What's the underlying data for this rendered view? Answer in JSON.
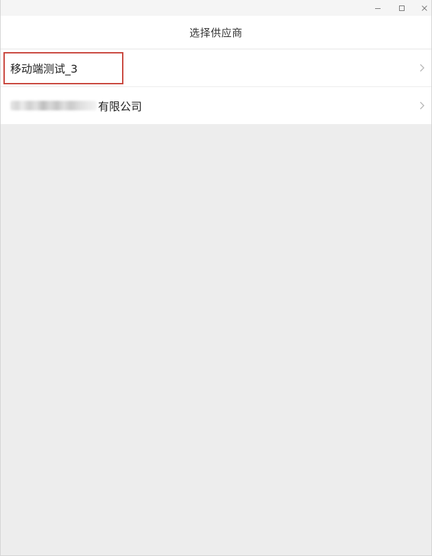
{
  "window": {
    "controls": {
      "minimize_icon": "minimize-icon",
      "maximize_icon": "maximize-icon",
      "close_icon": "close-icon"
    }
  },
  "navbar": {
    "title": "选择供应商"
  },
  "suppliers": [
    {
      "label": "移动端测试_3",
      "highlighted": true
    },
    {
      "label": "有限公司",
      "redacted_prefix": true
    }
  ],
  "colors": {
    "highlight": "#c9463d",
    "background": "#ededed",
    "list_bg": "#ffffff"
  }
}
